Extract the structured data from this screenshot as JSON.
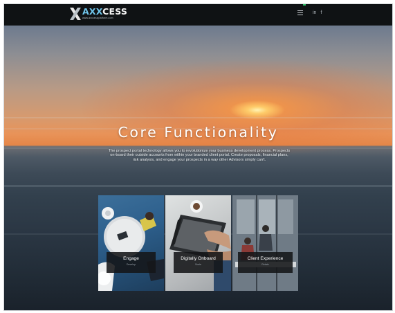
{
  "header": {
    "logo_text_prefix": "X",
    "logo_text_accent": "AXX",
    "logo_text_rest": "CESS",
    "logo_subtext": "www.axxcessplatform.com",
    "social": [
      "in",
      "f"
    ]
  },
  "hero": {
    "title": "Core Functionality",
    "description": "The prospect portal technology allows you to revolutionize your business development process. Prospects on-board their outside accounts from within your branded client portal. Create proposals, financial plans, risk analysis, and engage your prospects in a way other Advisors simply can't."
  },
  "cards": [
    {
      "title": "Engage",
      "subtitle": "Develop"
    },
    {
      "title": "Digitally Onboard",
      "subtitle": "Scale"
    },
    {
      "title": "Client Experience",
      "subtitle": "Retain"
    }
  ],
  "colors": {
    "logo_accent": "#6fc4ea",
    "nav_background": "#0f1214",
    "card_label_background": "#141618"
  },
  "icons": {
    "menu": "hamburger-menu-icon",
    "linkedin": "linkedin-icon",
    "facebook": "facebook-icon"
  }
}
